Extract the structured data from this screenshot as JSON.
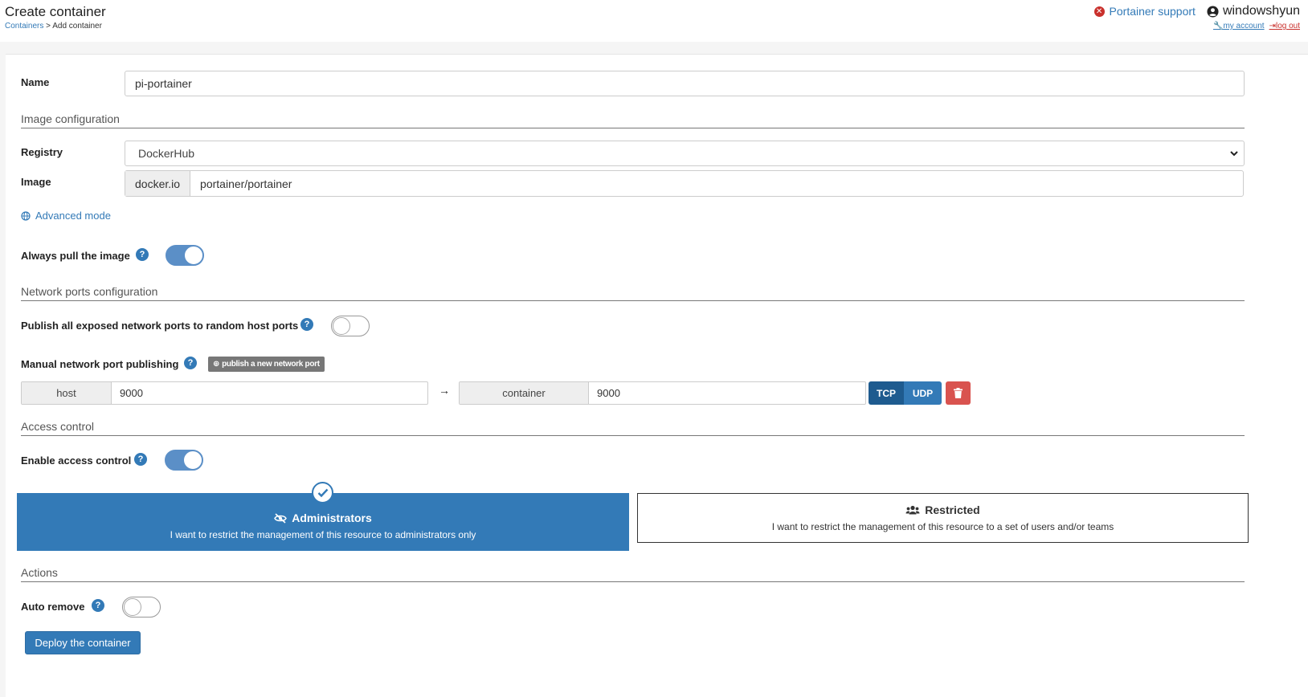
{
  "header": {
    "title": "Create container",
    "breadcrumb_link": "Containers",
    "breadcrumb_sep": ">",
    "breadcrumb_current": "Add container",
    "support_label": "Portainer support",
    "username": "windowshyun",
    "my_account": "my account",
    "log_out": "log out"
  },
  "form": {
    "name_label": "Name",
    "name_value": "pi-portainer",
    "image_section": "Image configuration",
    "registry_label": "Registry",
    "registry_value": "DockerHub",
    "image_label": "Image",
    "image_prefix": "docker.io",
    "image_value": "portainer/portainer",
    "advanced_mode": "Advanced mode",
    "always_pull_label": "Always pull the image",
    "always_pull_on": true
  },
  "network": {
    "section": "Network ports configuration",
    "publish_all_label": "Publish all exposed network ports to random host ports",
    "publish_all_on": false,
    "manual_label": "Manual network port publishing",
    "publish_new_button": "publish a new network port",
    "host_label": "host",
    "host_value": "9000",
    "arrow": "→",
    "container_label": "container",
    "container_value": "9000",
    "tcp": "TCP",
    "udp": "UDP"
  },
  "access": {
    "section": "Access control",
    "enable_label": "Enable access control",
    "enable_on": true,
    "admin_title": "Administrators",
    "admin_desc": "I want to restrict the management of this resource to administrators only",
    "restricted_title": "Restricted",
    "restricted_desc": "I want to restrict the management of this resource to a set of users and/or teams"
  },
  "actions": {
    "section": "Actions",
    "auto_remove_label": "Auto remove",
    "auto_remove_on": false,
    "deploy_button": "Deploy the container"
  },
  "colors": {
    "primary": "#337ab7",
    "danger": "#d9534f",
    "toggle_on": "#5b8fc7"
  }
}
